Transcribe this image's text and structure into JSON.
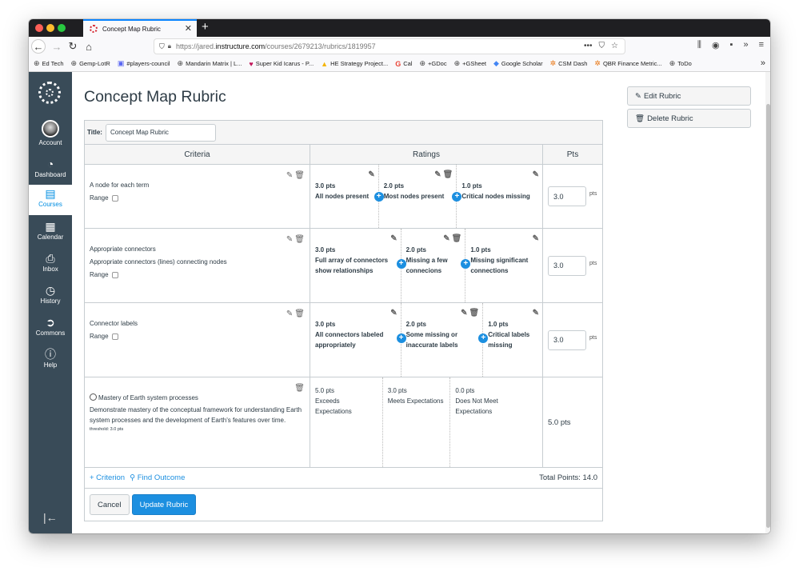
{
  "browser": {
    "tab_title": "Concept Map Rubric",
    "url_scheme": "https://jared.",
    "url_host": "instructure.com",
    "url_path": "/courses/2679213/rubrics/1819957",
    "bookmarks": [
      {
        "label": "Ed Tech",
        "icon": "⊕"
      },
      {
        "label": "Gemp-LotR",
        "icon": "⊕"
      },
      {
        "label": "#players-council",
        "icon": "▣"
      },
      {
        "label": "Mandarin Matrix | L...",
        "icon": "⊕"
      },
      {
        "label": "Super Kid Icarus - P...",
        "icon": "♥"
      },
      {
        "label": "HE Strategy Project...",
        "icon": "▲"
      },
      {
        "label": "Cal",
        "icon": "G"
      },
      {
        "label": "+GDoc",
        "icon": "⊕"
      },
      {
        "label": "+GSheet",
        "icon": "⊕"
      },
      {
        "label": "Google Scholar",
        "icon": "◆"
      },
      {
        "label": "CSM Dash",
        "icon": "✲"
      },
      {
        "label": "QBR Finance Metric...",
        "icon": "✲"
      },
      {
        "label": "ToDo",
        "icon": "⊕"
      }
    ]
  },
  "sidebar": {
    "items": [
      {
        "label": "Account",
        "icon": "avatar"
      },
      {
        "label": "Dashboard",
        "icon": "◔"
      },
      {
        "label": "Courses",
        "icon": "▤"
      },
      {
        "label": "Calendar",
        "icon": "▦"
      },
      {
        "label": "Inbox",
        "icon": "⎙"
      },
      {
        "label": "History",
        "icon": "◷"
      },
      {
        "label": "Commons",
        "icon": "➲"
      },
      {
        "label": "Help",
        "icon": "ⓘ"
      }
    ],
    "collapse_icon": "|←"
  },
  "page": {
    "title": "Concept Map Rubric",
    "title_label": "Title:",
    "title_value": "Concept Map Rubric",
    "headers": {
      "criteria": "Criteria",
      "ratings": "Ratings",
      "pts": "Pts"
    },
    "range_label": "Range",
    "pts_unit": "pts",
    "criteria": [
      {
        "name": "A node for each term",
        "description": "",
        "points": "3.0",
        "ratings": [
          {
            "pts": "3.0 pts",
            "desc": "All nodes present"
          },
          {
            "pts": "2.0 pts",
            "desc": "Most nodes present"
          },
          {
            "pts": "1.0 pts",
            "desc": "Critical nodes missing"
          }
        ]
      },
      {
        "name": "Appropriate connectors",
        "description": "Appropriate connectors (lines) connecting nodes",
        "points": "3.0",
        "ratings": [
          {
            "pts": "3.0 pts",
            "desc": "Full array of connectors show relationships"
          },
          {
            "pts": "2.0 pts",
            "desc": "Missing a few connecions"
          },
          {
            "pts": "1.0 pts",
            "desc": "Missing significant connections"
          }
        ]
      },
      {
        "name": "Connector labels",
        "description": "",
        "points": "3.0",
        "ratings": [
          {
            "pts": "3.0 pts",
            "desc": "All connectors labeled appropriately"
          },
          {
            "pts": "2.0 pts",
            "desc": "Some missing or inaccurate labels"
          },
          {
            "pts": "1.0 pts",
            "desc": "Critical labels missing"
          }
        ]
      }
    ],
    "outcome": {
      "name": "Mastery of Earth system processes",
      "description": "Demonstrate mastery of the conceptual framework for understanding Earth system processes and the development of Earth's features over time.",
      "threshold": "threshold: 3.0 pts",
      "points": "5.0 pts",
      "ratings": [
        {
          "pts": "5.0 pts",
          "desc": "Exceeds Expectations"
        },
        {
          "pts": "3.0 pts",
          "desc": "Meets Expectations"
        },
        {
          "pts": "0.0 pts",
          "desc": "Does Not Meet Expectations"
        }
      ]
    },
    "add_criterion": "+ Criterion",
    "find_outcome": "Find Outcome",
    "total_points": "Total Points: 14.0",
    "cancel_label": "Cancel",
    "update_label": "Update Rubric",
    "edit_rubric_label": "Edit Rubric",
    "delete_rubric_label": "Delete Rubric"
  }
}
